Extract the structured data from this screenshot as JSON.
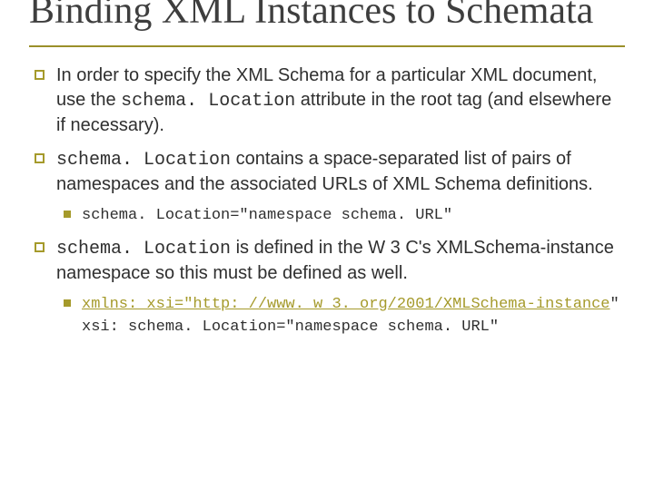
{
  "title": "Binding XML Instances to Schemata",
  "bullets": {
    "b1_part1": "In order to specify the XML Schema for a particular XML document, use the ",
    "b1_code": "schema. Location",
    "b1_part2": " attribute in the root tag (and elsewhere if necessary).",
    "b2_code": "schema. Location",
    "b2_part2": " contains a space-separated list of pairs of namespaces and the associated URLs of XML Schema definitions.",
    "b2_sub1": "schema. Location=\"namespace schema. URL\"",
    "b3_code": "schema. Location",
    "b3_part2": " is defined in the W 3 C's XMLSchema-instance namespace so this must be defined as well.",
    "b3_sub1_link": "xmlns: xsi=\"http: //www. w 3. org/2001/XMLSchema-instance",
    "b3_sub1_tail": "\"",
    "b3_sub2": "xsi: schema. Location=\"namespace schema. URL\""
  }
}
